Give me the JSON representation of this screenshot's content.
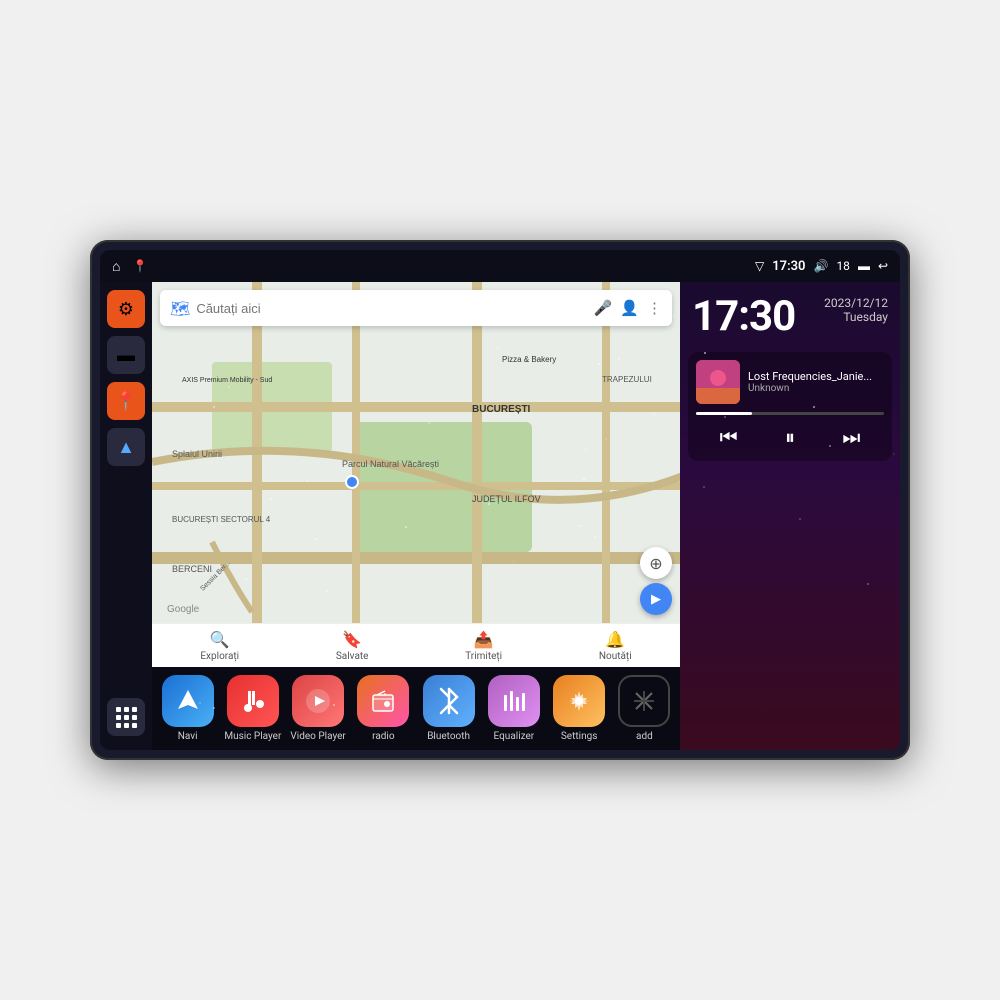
{
  "device": {
    "title": "Car Android Head Unit"
  },
  "statusBar": {
    "leftIcons": [
      "home-icon",
      "maps-icon"
    ],
    "time": "17:30",
    "rightIcons": [
      "wifi-icon",
      "volume-icon",
      "signal-icon",
      "battery-icon",
      "back-icon"
    ],
    "signal": "18"
  },
  "sidebar": {
    "icons": [
      {
        "name": "settings-icon",
        "type": "orange",
        "symbol": "⚙"
      },
      {
        "name": "files-icon",
        "type": "dark",
        "symbol": "📁"
      },
      {
        "name": "maps-icon",
        "type": "orange",
        "symbol": "📍"
      },
      {
        "name": "navigate-icon",
        "type": "dark",
        "symbol": "▲"
      }
    ],
    "gridIcon": "grid-icon"
  },
  "map": {
    "searchPlaceholder": "Căutați aici",
    "places": [
      "AXIS Premium Mobility - Sud",
      "Pizza & Bakery",
      "Parcul Natural Văcărești",
      "BUCUREȘTI",
      "JUDEȚUL ILFOV",
      "BUCUREȘTI SECTORUL 4",
      "BERCENI",
      "TRAPEZULUI"
    ],
    "bottomItems": [
      {
        "label": "Explorați",
        "icon": "🔍"
      },
      {
        "label": "Salvate",
        "icon": "🔖"
      },
      {
        "label": "Trimiteți",
        "icon": "📤"
      },
      {
        "label": "Noutăți",
        "icon": "🔔"
      }
    ]
  },
  "clock": {
    "time": "17:30",
    "date": "2023/12/12",
    "day": "Tuesday"
  },
  "music": {
    "title": "Lost Frequencies_Janie...",
    "artist": "Unknown",
    "prevIcon": "⏮",
    "pauseIcon": "⏸",
    "nextIcon": "⏭",
    "progress": 30
  },
  "apps": [
    {
      "name": "navi-app",
      "label": "Navi",
      "colorClass": "icon-navi",
      "symbol": "▲"
    },
    {
      "name": "music-app",
      "label": "Music Player",
      "colorClass": "icon-music",
      "symbol": "🎵"
    },
    {
      "name": "video-app",
      "label": "Video Player",
      "colorClass": "icon-video",
      "symbol": "▶"
    },
    {
      "name": "radio-app",
      "label": "radio",
      "colorClass": "icon-radio",
      "symbol": "📻"
    },
    {
      "name": "bluetooth-app",
      "label": "Bluetooth",
      "colorClass": "icon-bt",
      "symbol": "⚡"
    },
    {
      "name": "equalizer-app",
      "label": "Equalizer",
      "colorClass": "icon-eq",
      "symbol": "🎚"
    },
    {
      "name": "settings-app",
      "label": "Settings",
      "colorClass": "icon-settings",
      "symbol": "⚙"
    },
    {
      "name": "add-app",
      "label": "add",
      "colorClass": "icon-add",
      "symbol": "+"
    }
  ]
}
